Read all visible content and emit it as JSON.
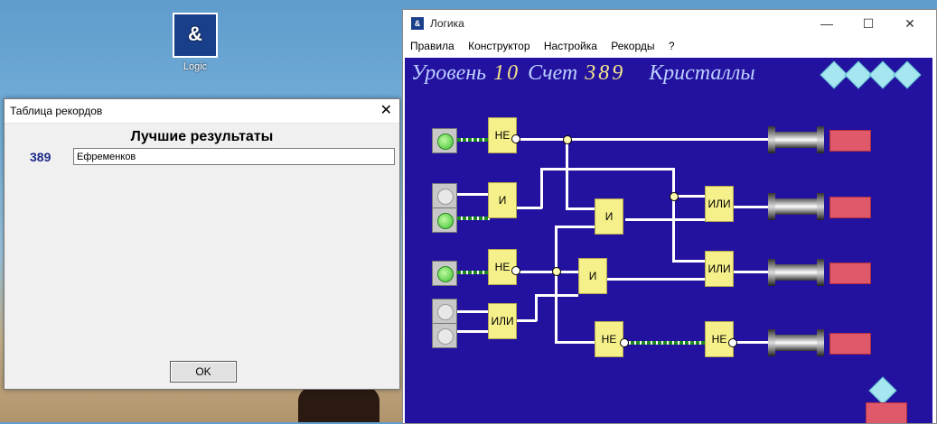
{
  "desktop": {
    "icon_label": "Logic",
    "icon_glyph": "&"
  },
  "records_dialog": {
    "title": "Таблица рекордов",
    "close_glyph": "✕",
    "heading": "Лучшие результаты",
    "score": "389",
    "name_value": "Ефременков",
    "ok_label": "OK"
  },
  "game_window": {
    "title": "Логика",
    "icon_glyph": "&",
    "controls": {
      "minimize": "—",
      "maximize": "☐",
      "close": "✕"
    },
    "menu": [
      "Правила",
      "Конструктор",
      "Настройка",
      "Рекорды",
      "?"
    ],
    "level_label": "Уровень",
    "level_value": "10",
    "score_label": "Счет",
    "score_value": "389",
    "crystals_label": "Кристаллы",
    "crystal_count": 4,
    "gates": [
      {
        "label": "НЕ"
      },
      {
        "label": "И"
      },
      {
        "label": "НЕ"
      },
      {
        "label": "ИЛИ"
      },
      {
        "label": "И"
      },
      {
        "label": "И"
      },
      {
        "label": "НЕ"
      },
      {
        "label": "ИЛИ"
      },
      {
        "label": "ИЛИ"
      },
      {
        "label": "НЕ"
      }
    ],
    "inputs": [
      {
        "state": "on"
      },
      {
        "state": "off"
      },
      {
        "state": "on"
      },
      {
        "state": "on"
      },
      {
        "state": "off"
      },
      {
        "state": "off"
      }
    ]
  },
  "colors": {
    "board": "#23129f",
    "gate": "#f5f08a",
    "lamp": "#e0596a"
  }
}
